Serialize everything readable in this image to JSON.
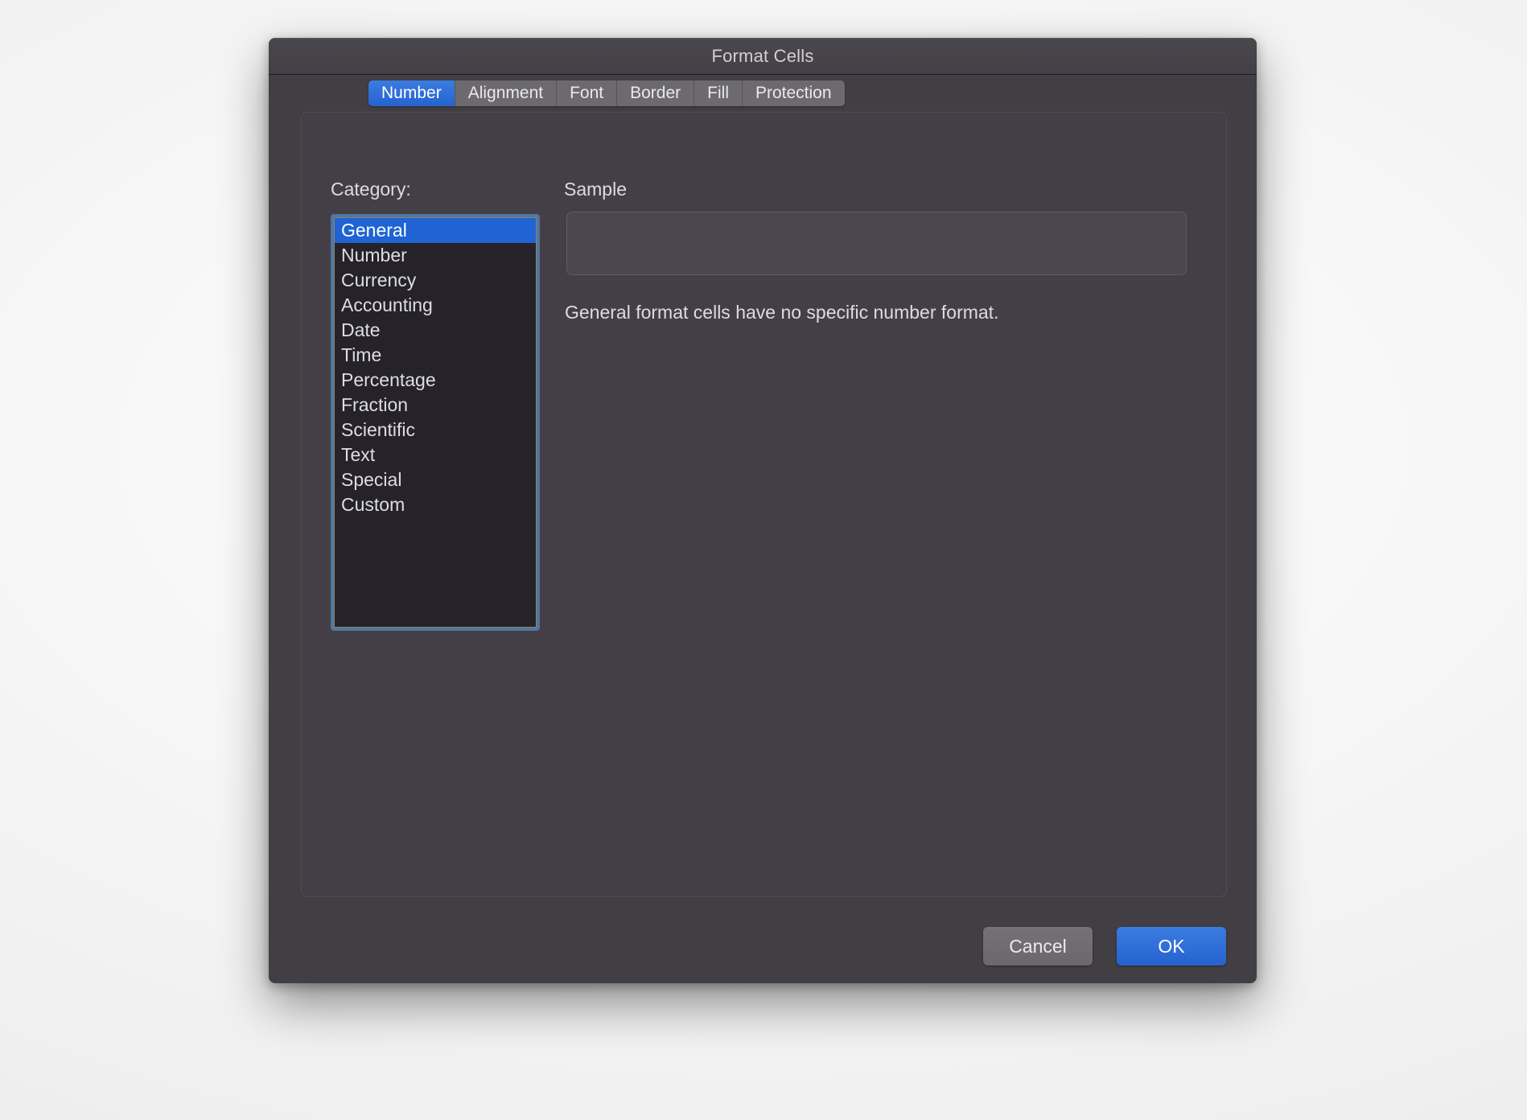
{
  "window": {
    "title": "Format Cells"
  },
  "tabs": [
    {
      "label": "Number",
      "active": true
    },
    {
      "label": "Alignment",
      "active": false
    },
    {
      "label": "Font",
      "active": false
    },
    {
      "label": "Border",
      "active": false
    },
    {
      "label": "Fill",
      "active": false
    },
    {
      "label": "Protection",
      "active": false
    }
  ],
  "category": {
    "label": "Category:",
    "items": [
      {
        "label": "General",
        "selected": true
      },
      {
        "label": "Number",
        "selected": false
      },
      {
        "label": "Currency",
        "selected": false
      },
      {
        "label": "Accounting",
        "selected": false
      },
      {
        "label": "Date",
        "selected": false
      },
      {
        "label": "Time",
        "selected": false
      },
      {
        "label": "Percentage",
        "selected": false
      },
      {
        "label": "Fraction",
        "selected": false
      },
      {
        "label": "Scientific",
        "selected": false
      },
      {
        "label": "Text",
        "selected": false
      },
      {
        "label": "Special",
        "selected": false
      },
      {
        "label": "Custom",
        "selected": false
      }
    ]
  },
  "sample": {
    "label": "Sample",
    "value": ""
  },
  "description": "General format cells have no specific number format.",
  "buttons": {
    "cancel": "Cancel",
    "ok": "OK"
  },
  "colors": {
    "accent": "#2563cf",
    "selection": "#1f63d4",
    "focus_ring": "#5176a0",
    "dialog_bg": "#413e44",
    "panel_bg": "#443f47",
    "list_bg": "#252329",
    "text": "#dedce0"
  }
}
